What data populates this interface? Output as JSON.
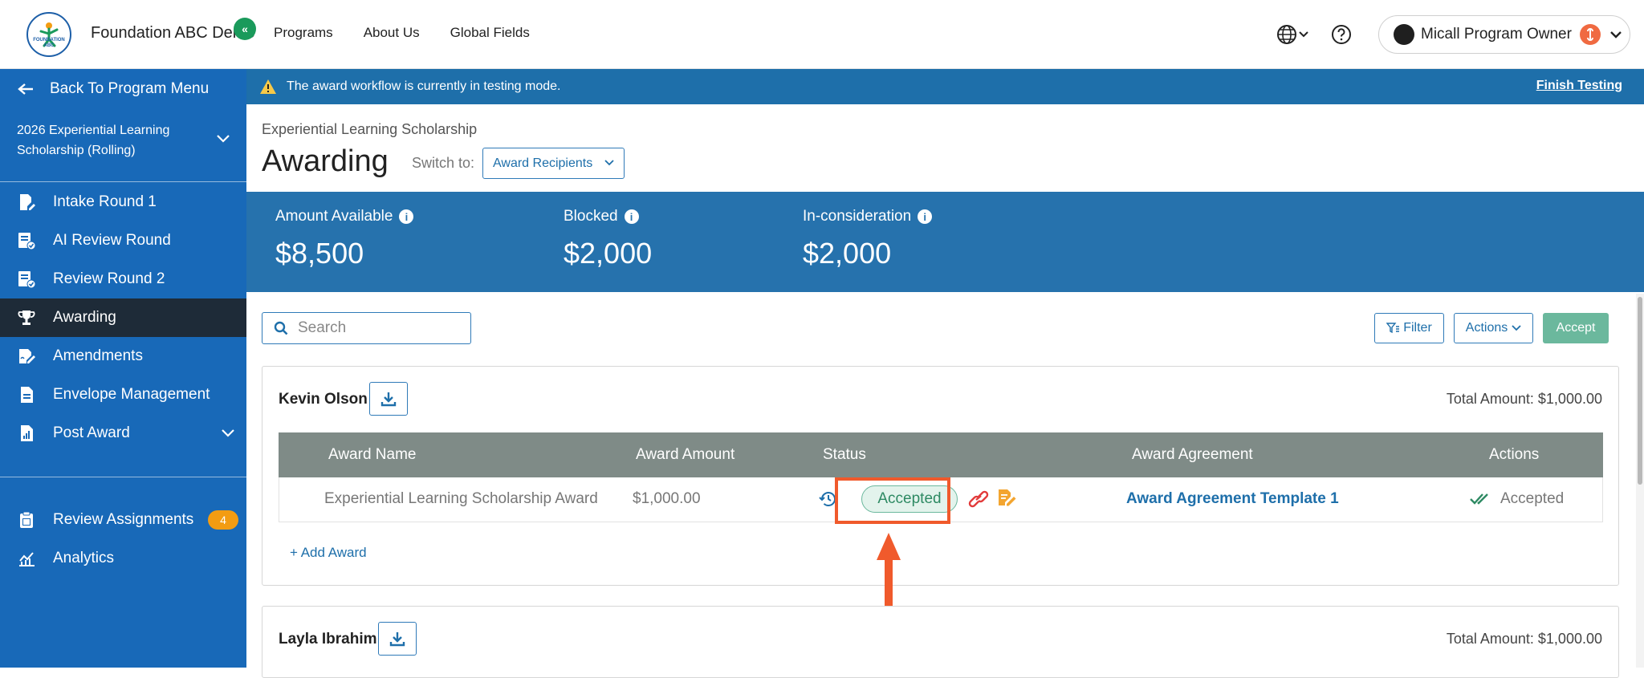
{
  "app": {
    "org_name": "Foundation ABC Demo",
    "logo_text": "FOUNDATION ABC",
    "nav": [
      "Programs",
      "About Us",
      "Global Fields"
    ],
    "user_name": "Micall Program Owner"
  },
  "sidebar": {
    "back_label": "Back To Program Menu",
    "collapse_label": "«",
    "program": "2026 Experiential Learning Scholarship (Rolling)",
    "items": [
      {
        "label": "Intake Round 1"
      },
      {
        "label": "AI Review Round"
      },
      {
        "label": "Review Round 2"
      },
      {
        "label": "Awarding"
      },
      {
        "label": "Amendments"
      },
      {
        "label": "Envelope Management"
      },
      {
        "label": "Post Award"
      }
    ],
    "bottom_items": [
      {
        "label": "Review Assignments",
        "badge": "4"
      },
      {
        "label": "Analytics"
      }
    ]
  },
  "banner": {
    "message": "The award workflow is currently in testing mode.",
    "link": "Finish Testing"
  },
  "header": {
    "breadcrumb": "Experiential Learning Scholarship",
    "title": "Awarding",
    "switch_label": "Switch to:",
    "switch_value": "Award Recipients"
  },
  "stats": [
    {
      "label": "Amount Available",
      "value": "$8,500"
    },
    {
      "label": "Blocked",
      "value": "$2,000"
    },
    {
      "label": "In-consideration",
      "value": "$2,000"
    }
  ],
  "toolbar": {
    "search_placeholder": "Search",
    "filter_label": "Filter",
    "actions_label": "Actions",
    "accept_label": "Accept"
  },
  "table_headers": [
    "Award Name",
    "Award Amount",
    "Status",
    "Award Agreement",
    "Actions"
  ],
  "recipients": [
    {
      "name": "Kevin Olson",
      "total": "Total Amount: $1,000.00",
      "award_name": "Experiential Learning Scholarship Award",
      "award_amount": "$1,000.00",
      "status": "Accepted",
      "agreement": "Award Agreement Template 1",
      "action": "Accepted",
      "add_award": "+ Add Award"
    },
    {
      "name": "Layla Ibrahim",
      "total": "Total Amount: $1,000.00"
    }
  ],
  "colors": {
    "sidebar": "#1869b8",
    "active_item": "#1e2b38",
    "banner": "#1e6faa",
    "stats": "#2672ad",
    "accept_button": "#6bb89d",
    "highlight": "#f05a2c"
  }
}
